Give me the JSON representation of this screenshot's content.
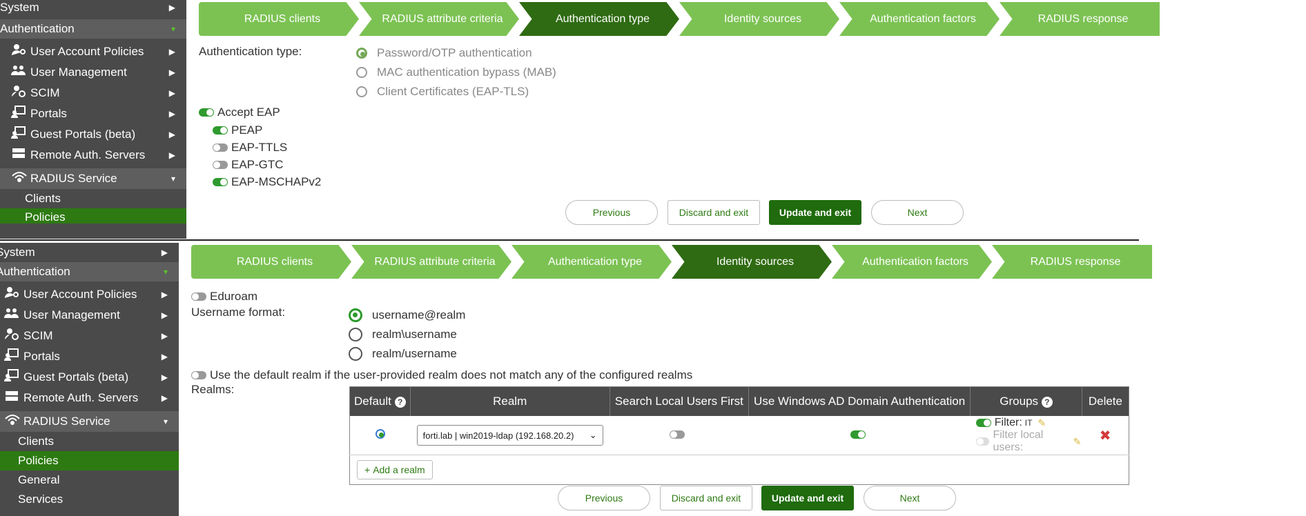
{
  "sidebar": {
    "system": "System",
    "authentication": "Authentication",
    "items": [
      {
        "label": "User Account Policies",
        "icon": "user-key-icon"
      },
      {
        "label": "User Management",
        "icon": "users-icon"
      },
      {
        "label": "SCIM",
        "icon": "user-gear-icon"
      },
      {
        "label": "Portals",
        "icon": "portal-icon"
      },
      {
        "label": "Guest Portals (beta)",
        "icon": "portal-icon"
      },
      {
        "label": "Remote Auth. Servers",
        "icon": "server-icon"
      },
      {
        "label": "RADIUS Service",
        "icon": "radius-icon"
      }
    ],
    "sub_items": [
      "Clients",
      "Policies",
      "General",
      "Services"
    ]
  },
  "wizard_steps": [
    "RADIUS clients",
    "RADIUS attribute criteria",
    "Authentication type",
    "Identity sources",
    "Authentication factors",
    "RADIUS response"
  ],
  "top": {
    "auth_type_label": "Authentication type:",
    "auth_options": [
      "Password/OTP authentication",
      "MAC authentication bypass (MAB)",
      "Client Certificates (EAP-TLS)"
    ],
    "accept_eap": "Accept EAP",
    "eap_options": [
      "PEAP",
      "EAP-TTLS",
      "EAP-GTC",
      "EAP-MSCHAPv2"
    ]
  },
  "bottom": {
    "eduroam": "Eduroam",
    "username_format_label": "Username format:",
    "username_formats": [
      "username@realm",
      "realm\\username",
      "realm/username"
    ],
    "default_realm_text": "Use the default realm if the user-provided realm does not match any of the configured realms",
    "realms_label": "Realms:",
    "table_headers": [
      "Default",
      "Realm",
      "Search Local Users First",
      "Use Windows AD Domain Authentication",
      "Groups",
      "Delete"
    ],
    "realm_select_value": "forti.lab | win2019-ldap (192.168.20.2)",
    "filter_label": "Filter:",
    "filter_value": "IT",
    "filter_local_users": "Filter local users:",
    "add_realm": "Add a realm"
  },
  "buttons": {
    "previous": "Previous",
    "discard": "Discard and exit",
    "update": "Update and exit",
    "next": "Next"
  },
  "colors": {
    "step": "#7cc253",
    "step_active": "#2f6b12",
    "sidebar": "#4a4a4a",
    "accent": "#1f6b0d"
  }
}
